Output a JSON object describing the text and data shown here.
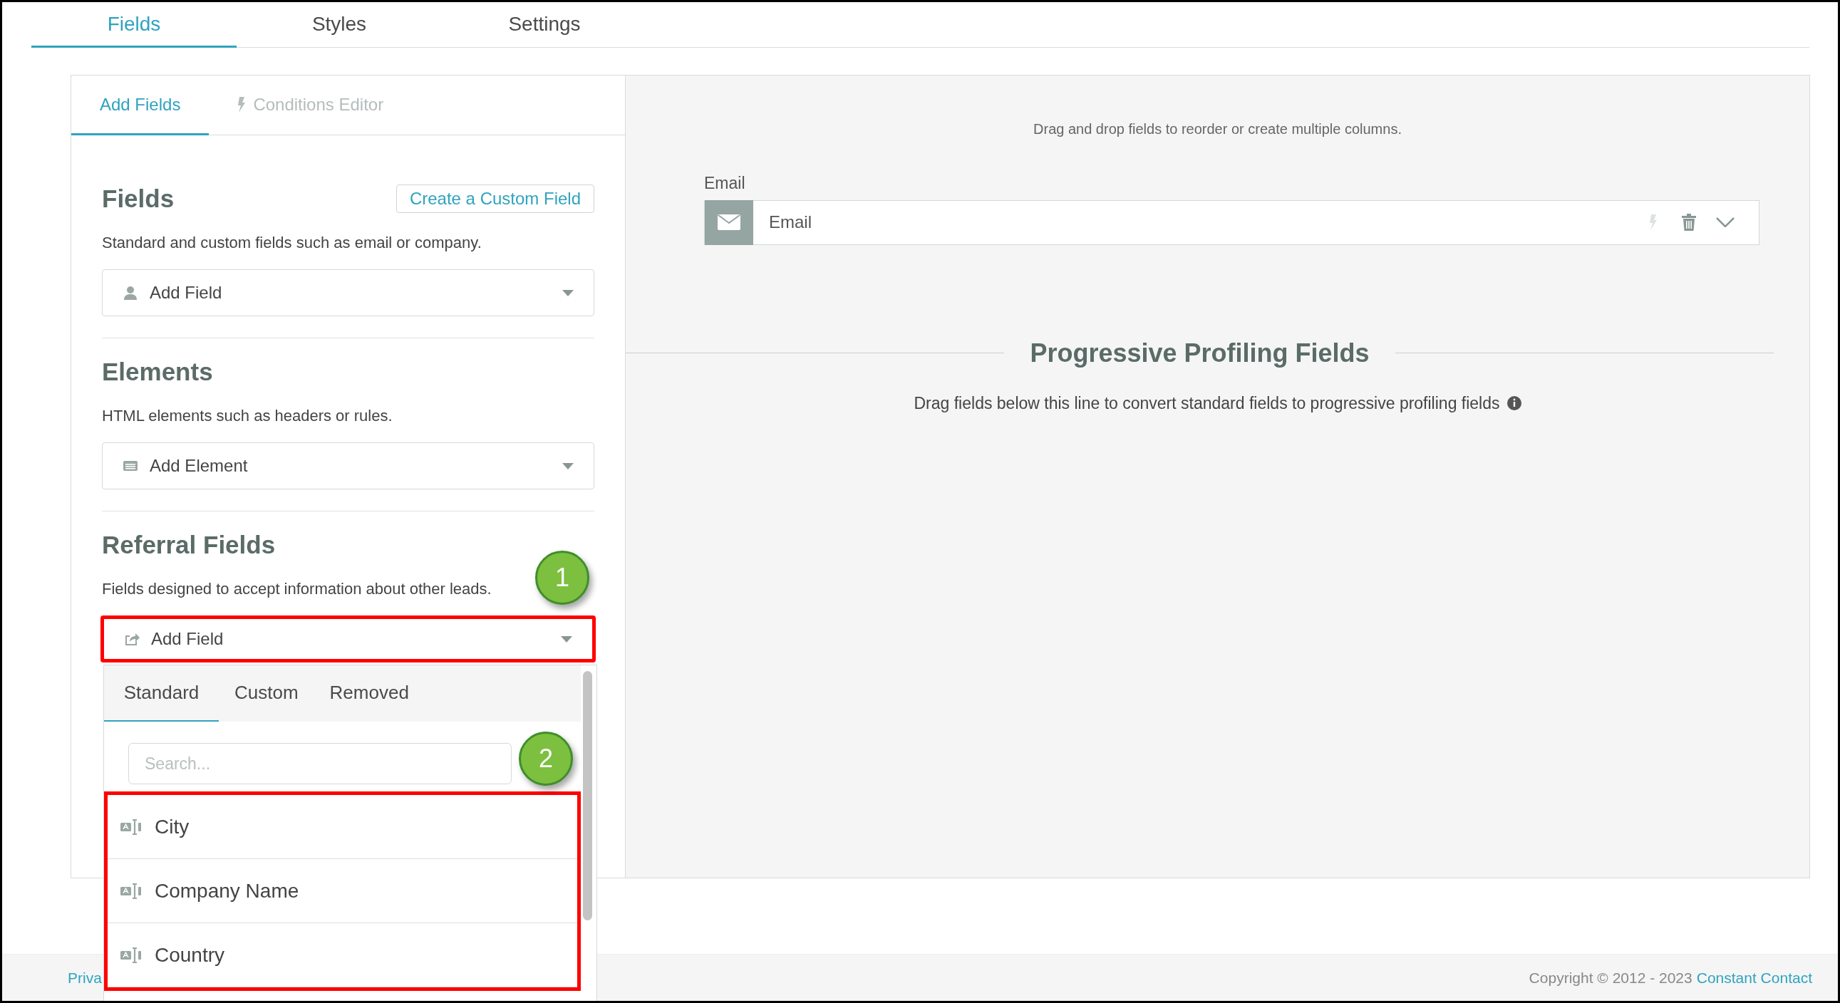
{
  "top_tabs": [
    {
      "label": "Fields",
      "selected": true
    },
    {
      "label": "Styles",
      "selected": false
    },
    {
      "label": "Settings",
      "selected": false
    }
  ],
  "left_panel": {
    "tabs": [
      {
        "label": "Add Fields",
        "selected": true,
        "disabled": false
      },
      {
        "label": "Conditions Editor",
        "selected": false,
        "disabled": true
      }
    ],
    "sections": [
      {
        "kind": "fields",
        "title": "Fields",
        "button": "Create a Custom Field",
        "description": "Standard and custom fields such as email or company.",
        "dropdown": "Add Field",
        "highlighted": false
      },
      {
        "kind": "elements",
        "title": "Elements",
        "description": "HTML elements such as headers or rules.",
        "dropdown": "Add Element",
        "highlighted": false
      },
      {
        "kind": "referral",
        "title": "Referral Fields",
        "description": "Fields designed to accept information about other leads.",
        "dropdown": "Add Field",
        "highlighted": true
      }
    ]
  },
  "referral_menu": {
    "tabs": [
      {
        "label": "Standard",
        "selected": true
      },
      {
        "label": "Custom",
        "selected": false
      },
      {
        "label": "Removed",
        "selected": false
      }
    ],
    "search": {
      "placeholder": "Search..."
    },
    "items": [
      {
        "label": "City"
      },
      {
        "label": "Company Name"
      },
      {
        "label": "Country"
      }
    ],
    "items_highlighted": true
  },
  "callouts": [
    {
      "label": "1"
    },
    {
      "label": "2"
    }
  ],
  "canvas": {
    "hint": "Drag and drop fields to reorder or create multiple columns.",
    "fields": [
      {
        "label": "Email",
        "value": "Email"
      }
    ],
    "progressive": {
      "title": "Progressive Profiling Fields",
      "description": "Drag fields below this line to convert standard fields to progressive profiling fields"
    }
  },
  "footer": {
    "link": "Priva",
    "copyright": "Copyright © 2012 - 2023",
    "company": "Constant Contact"
  }
}
